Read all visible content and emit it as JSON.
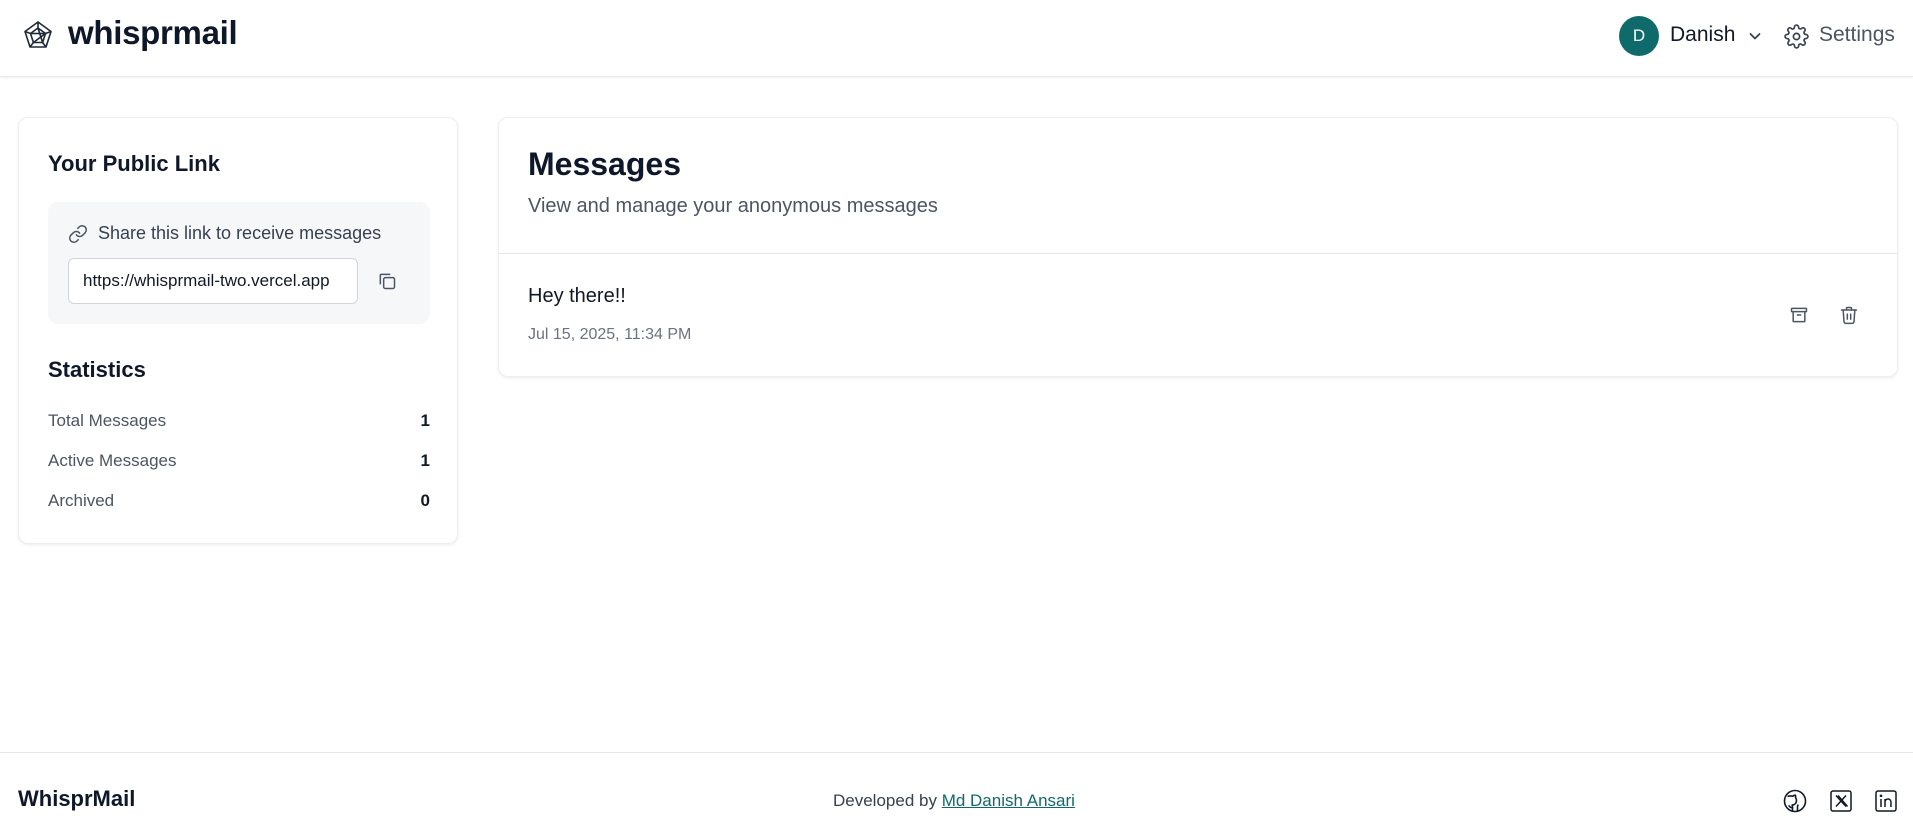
{
  "header": {
    "app_name": "whisprmail",
    "logo_icon": "pentagon-logo-icon",
    "user": {
      "initial": "D",
      "name": "Danish",
      "avatar_color": "#0f6b6b"
    },
    "settings_label": "Settings"
  },
  "public_link": {
    "title": "Your Public Link",
    "share_label": "Share this link to receive messages",
    "url": "https://whisprmail-two.vercel.app",
    "copy_icon": "copy-icon"
  },
  "statistics": {
    "title": "Statistics",
    "items": [
      {
        "label": "Total Messages",
        "value": "1"
      },
      {
        "label": "Active Messages",
        "value": "1"
      },
      {
        "label": "Archived",
        "value": "0"
      }
    ]
  },
  "messages": {
    "title": "Messages",
    "subtitle": "View and manage your anonymous messages",
    "items": [
      {
        "text": "Hey there!!",
        "date": "Jul 15, 2025, 11:34 PM"
      }
    ]
  },
  "footer": {
    "brand": "WhisprMail",
    "credit_prefix": "Developed by ",
    "credit_name": "Md Danish Ansari",
    "social_icons": [
      "github-icon",
      "x-icon",
      "linkedin-icon"
    ]
  },
  "colors": {
    "accent": "#0f6b6b",
    "text_primary": "#0f172a",
    "text_secondary": "#4b5563"
  }
}
